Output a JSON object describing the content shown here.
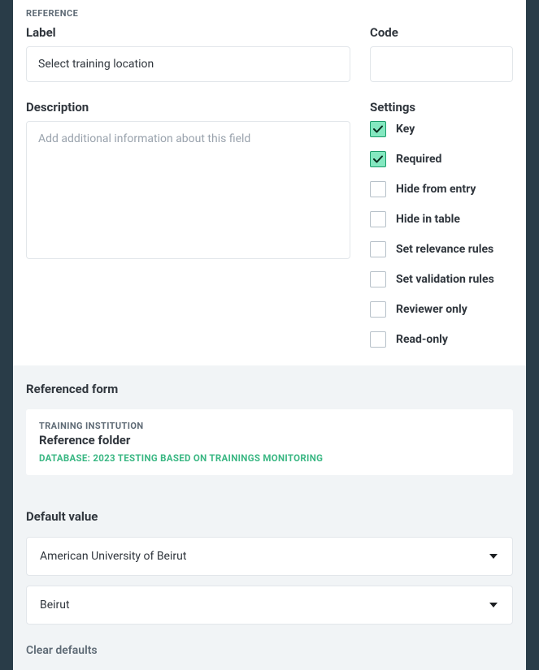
{
  "top": {
    "section_tag": "REFERENCE",
    "label_label": "Label",
    "label_value": "Select training location",
    "code_label": "Code",
    "code_value": "",
    "desc_label": "Description",
    "desc_placeholder": "Add additional information about this field",
    "desc_value": "",
    "settings_label": "Settings",
    "settings": [
      {
        "label": "Key",
        "checked": true
      },
      {
        "label": "Required",
        "checked": true
      },
      {
        "label": "Hide from entry",
        "checked": false
      },
      {
        "label": "Hide in table",
        "checked": false
      },
      {
        "label": "Set relevance rules",
        "checked": false
      },
      {
        "label": "Set validation rules",
        "checked": false
      },
      {
        "label": "Reviewer only",
        "checked": false
      },
      {
        "label": "Read-only",
        "checked": false
      }
    ]
  },
  "ref": {
    "heading": "Referenced form",
    "card_tag": "TRAINING INSTITUTION",
    "card_title": "Reference folder",
    "card_db": "DATABASE: 2023 TESTING BASED ON TRAININGS MONITORING"
  },
  "defaults": {
    "heading": "Default value",
    "values": [
      "American University of Beirut",
      "Beirut"
    ],
    "clear_label": "Clear defaults"
  }
}
